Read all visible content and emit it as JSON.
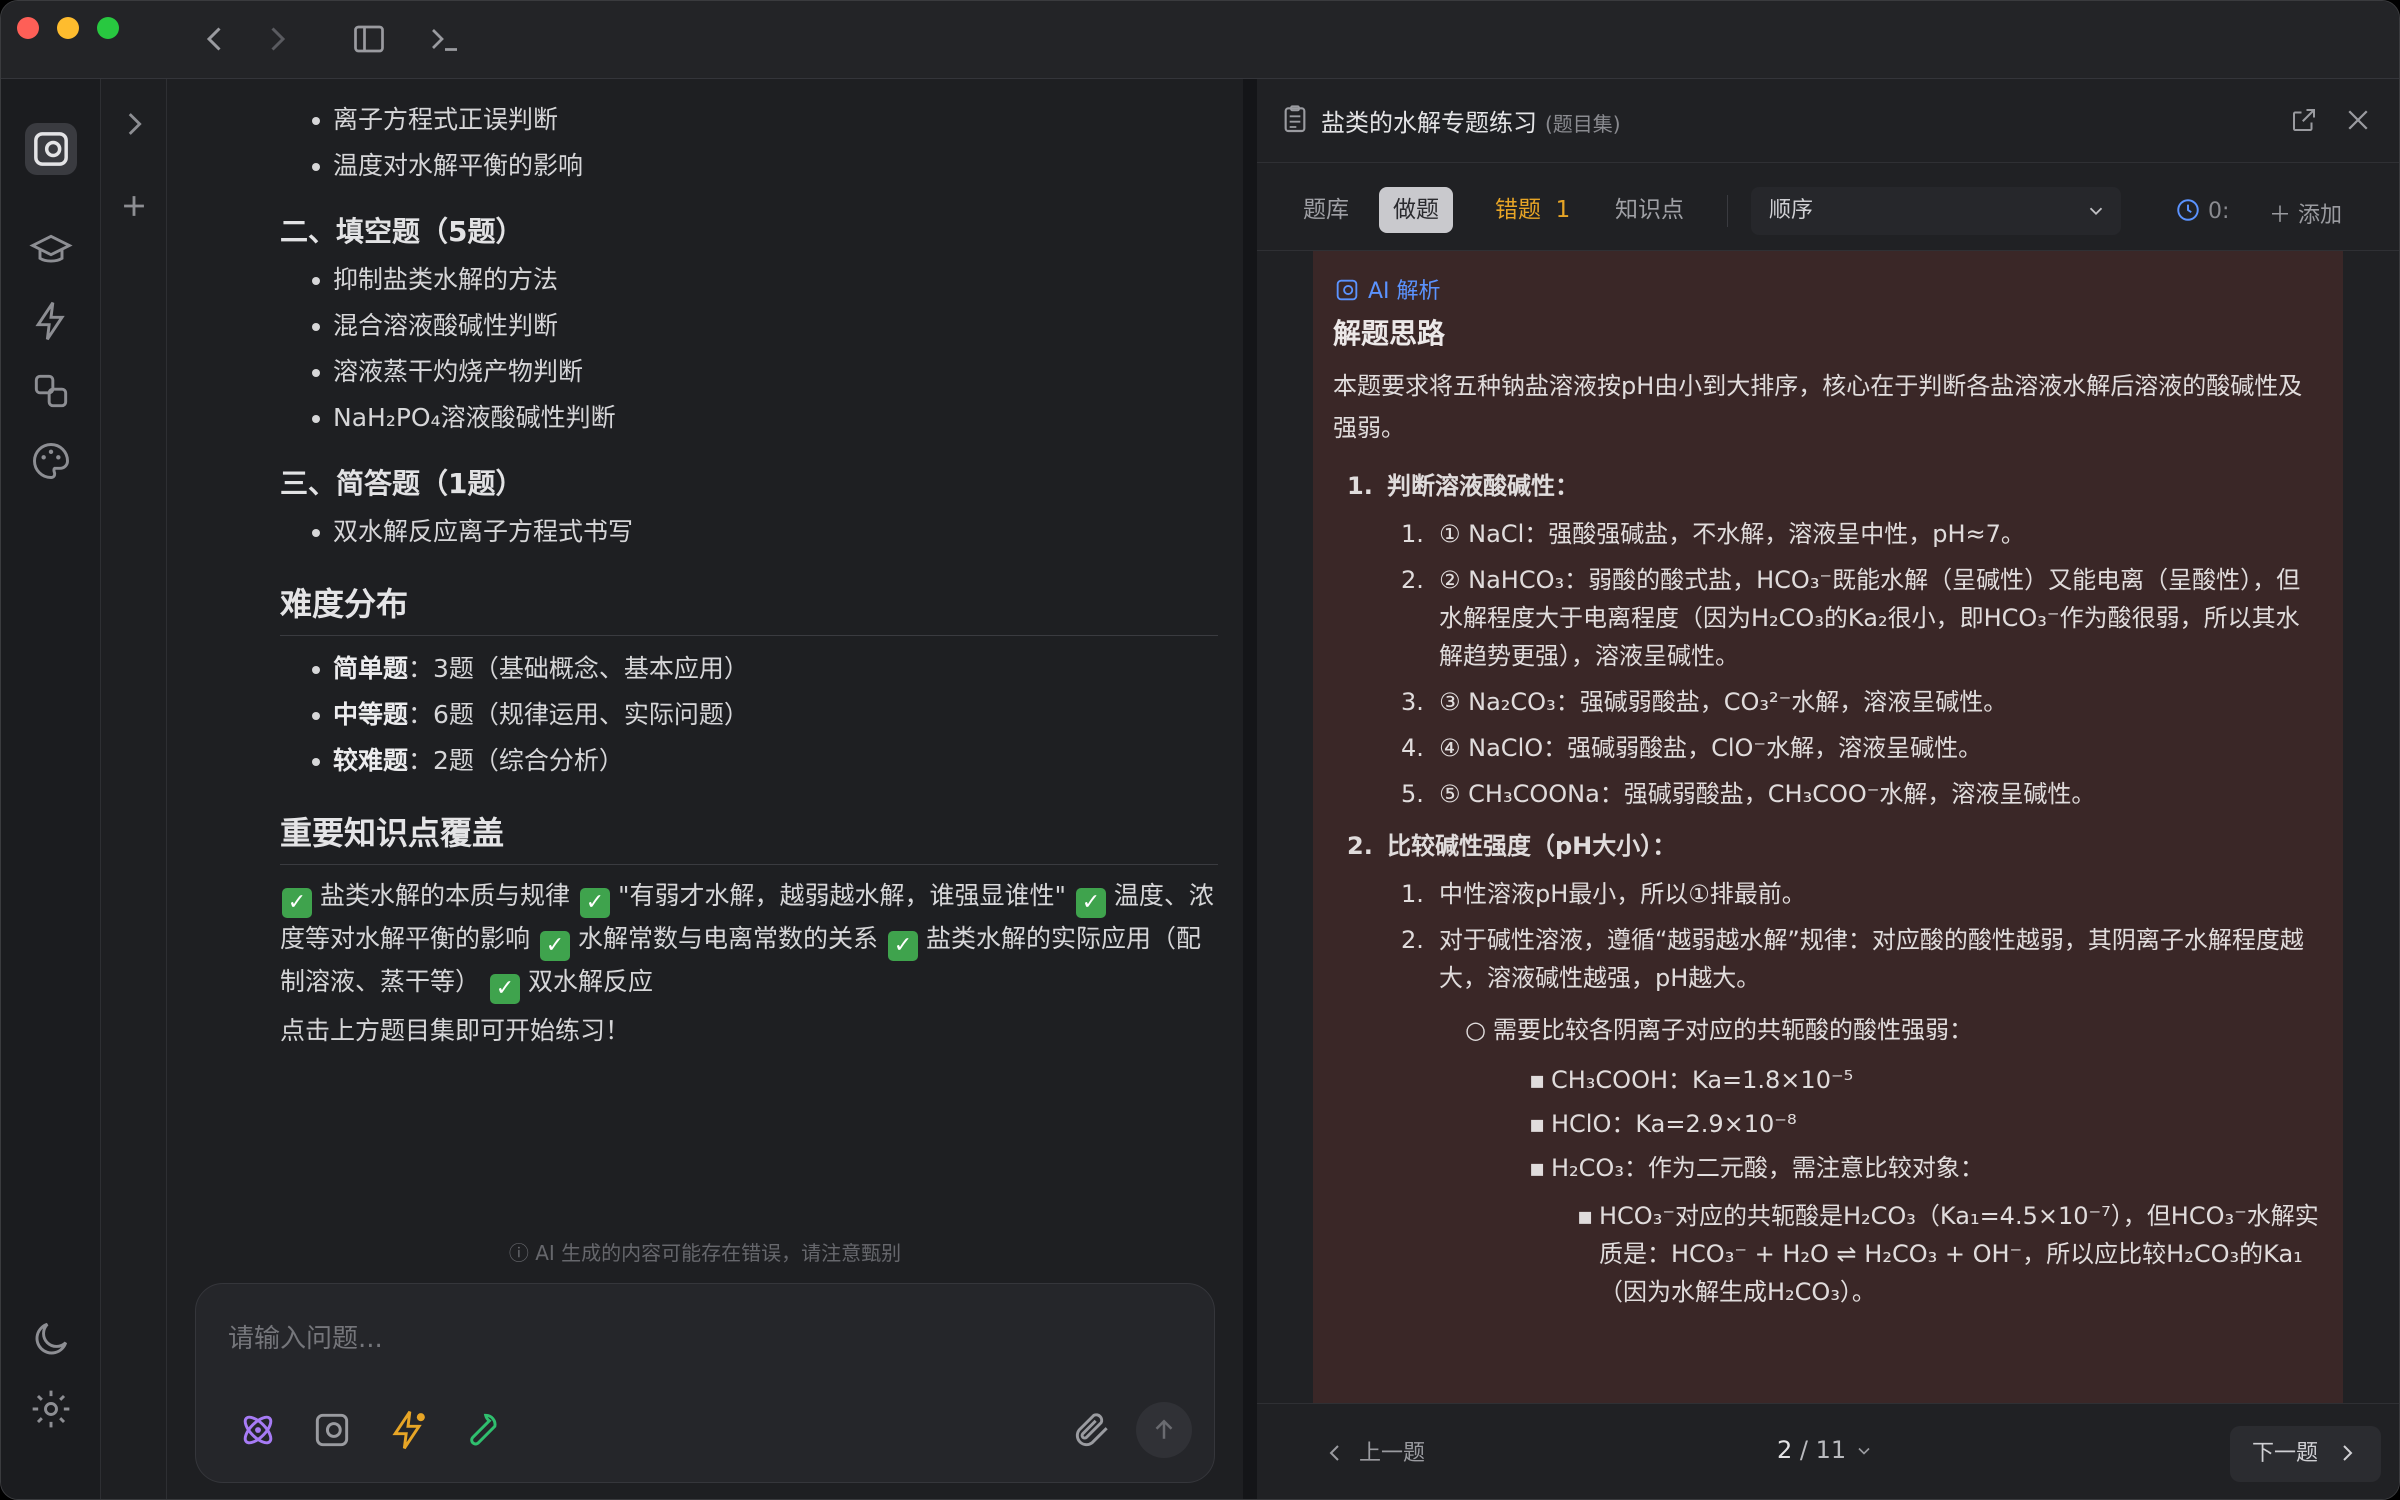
{
  "toolbar": {
    "back_icon": "chevron-left-icon",
    "forward_icon": "chevron-right-icon",
    "sidebar_icon": "sidebar-toggle-icon",
    "terminal_icon": "terminal-icon"
  },
  "chat": {
    "list_top": [
      "离子方程式正误判断",
      "温度对水解平衡的影响"
    ],
    "section2_title": "二、填空题（5题）",
    "section2_items": [
      "抑制盐类水解的方法",
      "混合溶液酸碱性判断",
      "溶液蒸干灼烧产物判断",
      "NaH₂PO₄溶液酸碱性判断"
    ],
    "section3_title": "三、简答题（1题）",
    "section3_items": [
      "双水解反应离子方程式书写"
    ],
    "difficulty_title": "难度分布",
    "difficulty": [
      {
        "label": "简单题",
        "value": "：3题（基础概念、基本应用）"
      },
      {
        "label": "中等题",
        "value": "：6题（规律运用、实际问题）"
      },
      {
        "label": "较难题",
        "value": "：2题（综合分析）"
      }
    ],
    "coverage_title": "重要知识点覆盖",
    "coverage": [
      "盐类水解的本质与规律",
      "\"有弱才水解，越弱越水解，谁强显谁性\"",
      "温度、浓度等对水解平衡的影响",
      "水解常数与电离常数的关系",
      "盐类水解的实际应用（配制溶液、蒸干等）",
      "双水解反应"
    ],
    "cta": "点击上方题目集即可开始练习！",
    "disclaimer": "ⓘ AI 生成的内容可能存在错误，请注意甄别",
    "input_placeholder": "请输入问题..."
  },
  "panel": {
    "title": "盐类的水解专题练习",
    "subtitle": "(题目集)",
    "tabs": {
      "bank": "题库",
      "practice": "做题",
      "wrong": "错题",
      "wrong_count": "1",
      "knowledge": "知识点"
    },
    "order": "顺序",
    "timer": "0:",
    "add": "添加",
    "ai_label": "AI 解析",
    "solution_title": "解题思路",
    "intro": "本题要求将五种钠盐溶液按pH由小到大排序，核心在于判断各盐溶液水解后溶液的酸碱性及强弱。",
    "step1_title": "判断溶液酸碱性：",
    "step1": [
      "① NaCl：强酸强碱盐，不水解，溶液呈中性，pH≈7。",
      "② NaHCO₃：弱酸的酸式盐，HCO₃⁻既能水解（呈碱性）又能电离（呈酸性），但水解程度大于电离程度（因为H₂CO₃的Ka₂很小，即HCO₃⁻作为酸很弱，所以其水解趋势更强），溶液呈碱性。",
      "③ Na₂CO₃：强碱弱酸盐，CO₃²⁻水解，溶液呈碱性。",
      "④ NaClO：强碱弱酸盐，ClO⁻水解，溶液呈碱性。",
      "⑤ CH₃COONa：强碱弱酸盐，CH₃COO⁻水解，溶液呈碱性。"
    ],
    "step2_title": "比较碱性强度（pH大小）：",
    "step2": [
      "中性溶液pH最小，所以①排最前。",
      "对于碱性溶液，遵循“越弱越水解”规律：对应酸的酸性越弱，其阴离子水解程度越大，溶液碱性越强，pH越大。"
    ],
    "sub_title": "需要比较各阴离子对应的共轭酸的酸性强弱：",
    "acids": [
      "CH₃COOH：Ka=1.8×10⁻⁵",
      "HClO：Ka=2.9×10⁻⁸",
      "H₂CO₃：作为二元酸，需注意比较对象："
    ],
    "deep": "HCO₃⁻对应的共轭酸是H₂CO₃（Ka₁=4.5×10⁻⁷），但HCO₃⁻水解实质是：HCO₃⁻ + H₂O ⇌ H₂CO₃ + OH⁻，所以应比较H₂CO₃的Ka₁（因为水解生成H₂CO₃）。",
    "prev": "上一题",
    "next": "下一题",
    "page_current": "2",
    "page_total": "/ 11"
  },
  "colors": {
    "accent_blue": "#5b93ff",
    "wrong_orange": "#e7a526",
    "check_green": "#3fa34d",
    "ai_bg": "#3a2727"
  }
}
